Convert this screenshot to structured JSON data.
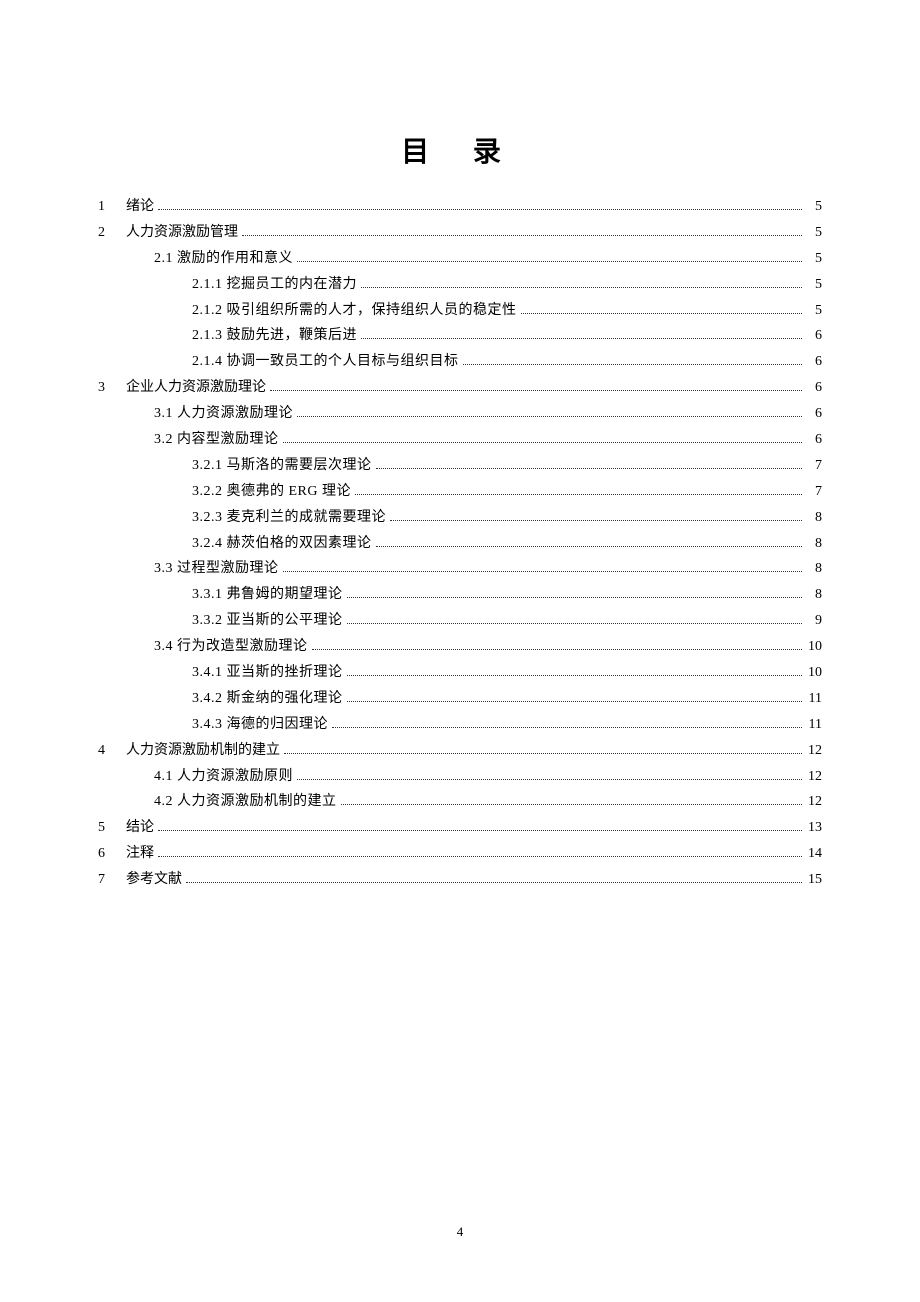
{
  "title": "目 录",
  "page_number": "4",
  "entries": [
    {
      "level": 0,
      "num": "1",
      "label": "绪论",
      "page": "5"
    },
    {
      "level": 0,
      "num": "2",
      "label": "人力资源激励管理",
      "page": "5"
    },
    {
      "level": 1,
      "num": "",
      "label": "2.1 激励的作用和意义",
      "page": "5"
    },
    {
      "level": 2,
      "num": "",
      "label": "2.1.1 挖掘员工的内在潜力",
      "page": "5"
    },
    {
      "level": 2,
      "num": "",
      "label": "2.1.2 吸引组织所需的人才，保持组织人员的稳定性",
      "page": "5"
    },
    {
      "level": 2,
      "num": "",
      "label": "2.1.3 鼓励先进，鞭策后进",
      "page": "6"
    },
    {
      "level": 2,
      "num": "",
      "label": "2.1.4 协调一致员工的个人目标与组织目标",
      "page": "6"
    },
    {
      "level": 0,
      "num": "3",
      "label": "企业人力资源激励理论",
      "page": "6"
    },
    {
      "level": 1,
      "num": "",
      "label": "3.1 人力资源激励理论",
      "page": "6"
    },
    {
      "level": 1,
      "num": "",
      "label": "3.2 内容型激励理论",
      "page": "6"
    },
    {
      "level": 2,
      "num": "",
      "label": "3.2.1 马斯洛的需要层次理论",
      "page": "7"
    },
    {
      "level": 2,
      "num": "",
      "label": "3.2.2 奥德弗的 ERG 理论",
      "page": "7"
    },
    {
      "level": 2,
      "num": "",
      "label": "3.2.3 麦克利兰的成就需要理论",
      "page": "8"
    },
    {
      "level": 2,
      "num": "",
      "label": "3.2.4 赫茨伯格的双因素理论",
      "page": "8"
    },
    {
      "level": 1,
      "num": "",
      "label": "3.3 过程型激励理论",
      "page": "8"
    },
    {
      "level": 2,
      "num": "",
      "label": "3.3.1 弗鲁姆的期望理论",
      "page": "8"
    },
    {
      "level": 2,
      "num": "",
      "label": "3.3.2 亚当斯的公平理论",
      "page": "9"
    },
    {
      "level": 1,
      "num": "",
      "label": "3.4 行为改造型激励理论",
      "page": "10"
    },
    {
      "level": 2,
      "num": "",
      "label": "3.4.1 亚当斯的挫折理论",
      "page": "10"
    },
    {
      "level": 2,
      "num": "",
      "label": "3.4.2 斯金纳的强化理论",
      "page": "11"
    },
    {
      "level": 2,
      "num": "",
      "label": "3.4.3 海德的归因理论",
      "page": "11"
    },
    {
      "level": 0,
      "num": "4",
      "label": "人力资源激励机制的建立",
      "page": "12"
    },
    {
      "level": 1,
      "num": "",
      "label": "4.1 人力资源激励原则",
      "page": "12"
    },
    {
      "level": 1,
      "num": "",
      "label": "4.2 人力资源激励机制的建立",
      "page": "12"
    },
    {
      "level": 0,
      "num": "5",
      "label": "结论",
      "page": "13"
    },
    {
      "level": 0,
      "num": "6",
      "label": "注释",
      "page": "14"
    },
    {
      "level": 0,
      "num": "7",
      "label": "参考文献",
      "page": "15"
    }
  ]
}
